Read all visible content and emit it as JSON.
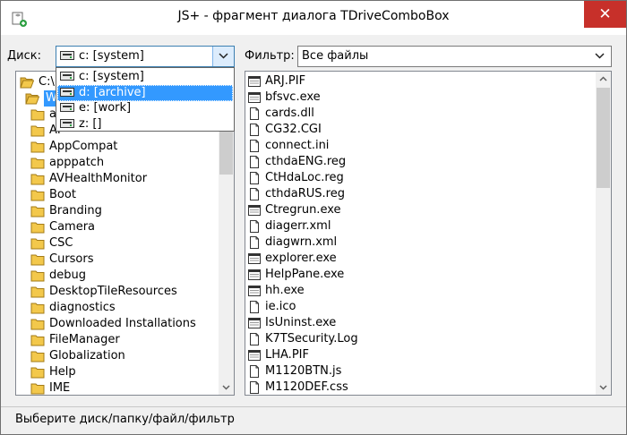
{
  "window": {
    "title": "JS+ - фрагмент диалога TDriveComboBox",
    "close_glyph": "✕"
  },
  "drive": {
    "label": "Диск:",
    "selected": "c: [system]",
    "options": [
      "c: [system]",
      "d: [archive]",
      "e: [work]",
      "z: []"
    ],
    "highlighted_index": 1
  },
  "filter": {
    "label": "Фильтр:",
    "selected": "Все файлы"
  },
  "folders": [
    {
      "name": "C:\\",
      "icon": "folder-open-icon",
      "indent": 0
    },
    {
      "name": "W",
      "icon": "folder-open-icon",
      "indent": 1,
      "selected": true
    },
    {
      "name": "a",
      "icon": "folder-icon",
      "indent": 2
    },
    {
      "name": "AI",
      "icon": "folder-icon",
      "indent": 2
    },
    {
      "name": "AppCompat",
      "icon": "folder-icon",
      "indent": 2
    },
    {
      "name": "apppatch",
      "icon": "folder-icon",
      "indent": 2
    },
    {
      "name": "AVHealthMonitor",
      "icon": "folder-icon",
      "indent": 2
    },
    {
      "name": "Boot",
      "icon": "folder-icon",
      "indent": 2
    },
    {
      "name": "Branding",
      "icon": "folder-icon",
      "indent": 2
    },
    {
      "name": "Camera",
      "icon": "folder-icon",
      "indent": 2
    },
    {
      "name": "CSC",
      "icon": "folder-icon",
      "indent": 2
    },
    {
      "name": "Cursors",
      "icon": "folder-icon",
      "indent": 2
    },
    {
      "name": "debug",
      "icon": "folder-icon",
      "indent": 2
    },
    {
      "name": "DesktopTileResources",
      "icon": "folder-icon",
      "indent": 2
    },
    {
      "name": "diagnostics",
      "icon": "folder-icon",
      "indent": 2
    },
    {
      "name": "Downloaded Installations",
      "icon": "folder-icon",
      "indent": 2
    },
    {
      "name": "FileManager",
      "icon": "folder-icon",
      "indent": 2
    },
    {
      "name": "Globalization",
      "icon": "folder-icon",
      "indent": 2
    },
    {
      "name": "Help",
      "icon": "folder-icon",
      "indent": 2
    },
    {
      "name": "IME",
      "icon": "folder-icon",
      "indent": 2
    }
  ],
  "files": [
    {
      "name": "ARJ.PIF",
      "icon": "program-icon"
    },
    {
      "name": "bfsvc.exe",
      "icon": "program-icon"
    },
    {
      "name": "cards.dll",
      "icon": "document-icon"
    },
    {
      "name": "CG32.CGI",
      "icon": "document-icon"
    },
    {
      "name": "connect.ini",
      "icon": "document-icon"
    },
    {
      "name": "cthdaENG.reg",
      "icon": "document-icon"
    },
    {
      "name": "CtHdaLoc.reg",
      "icon": "document-icon"
    },
    {
      "name": "cthdaRUS.reg",
      "icon": "document-icon"
    },
    {
      "name": "Ctregrun.exe",
      "icon": "program-icon"
    },
    {
      "name": "diagerr.xml",
      "icon": "document-icon"
    },
    {
      "name": "diagwrn.xml",
      "icon": "document-icon"
    },
    {
      "name": "explorer.exe",
      "icon": "program-icon"
    },
    {
      "name": "HelpPane.exe",
      "icon": "program-icon"
    },
    {
      "name": "hh.exe",
      "icon": "program-icon"
    },
    {
      "name": "ie.ico",
      "icon": "document-icon"
    },
    {
      "name": "IsUninst.exe",
      "icon": "program-icon"
    },
    {
      "name": "K7TSecurity.Log",
      "icon": "document-icon"
    },
    {
      "name": "LHA.PIF",
      "icon": "program-icon"
    },
    {
      "name": "M1120BTN.js",
      "icon": "document-icon"
    },
    {
      "name": "M1120DEF.css",
      "icon": "document-icon"
    }
  ],
  "status": {
    "text": "Выберите диск/папку/файл/фильтр"
  },
  "colors": {
    "selection": "#3399ff",
    "close_button": "#c7302a",
    "window_background": "#f0f0f0",
    "folder_yellow": "#f3c84b"
  }
}
